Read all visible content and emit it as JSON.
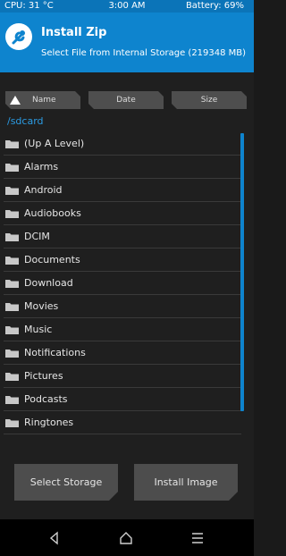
{
  "status": {
    "cpu": "CPU: 31 °C",
    "time": "3:00 AM",
    "battery": "Battery: 69%"
  },
  "header": {
    "title": "Install Zip",
    "subtitle": "Select File from Internal Storage (219348 MB)"
  },
  "sort": {
    "name_label": "Name",
    "date_label": "Date",
    "size_label": "Size",
    "active": "name",
    "direction": "ascending"
  },
  "path": "/sdcard",
  "files": [
    "(Up A Level)",
    "Alarms",
    "Android",
    "Audiobooks",
    "DCIM",
    "Documents",
    "Download",
    "Movies",
    "Music",
    "Notifications",
    "Pictures",
    "Podcasts",
    "Ringtones"
  ],
  "buttons": {
    "select_storage": "Select Storage",
    "install_image": "Install Image"
  },
  "colors": {
    "status_bar": "#0b74b8",
    "header": "#0e84ce",
    "accent": "#2b9be3",
    "button": "#4d4d4d"
  },
  "icons": {
    "logo": "twrp-logo-icon",
    "folder": "folder-icon",
    "back": "back-icon",
    "home": "home-icon",
    "menu": "menu-icon"
  }
}
